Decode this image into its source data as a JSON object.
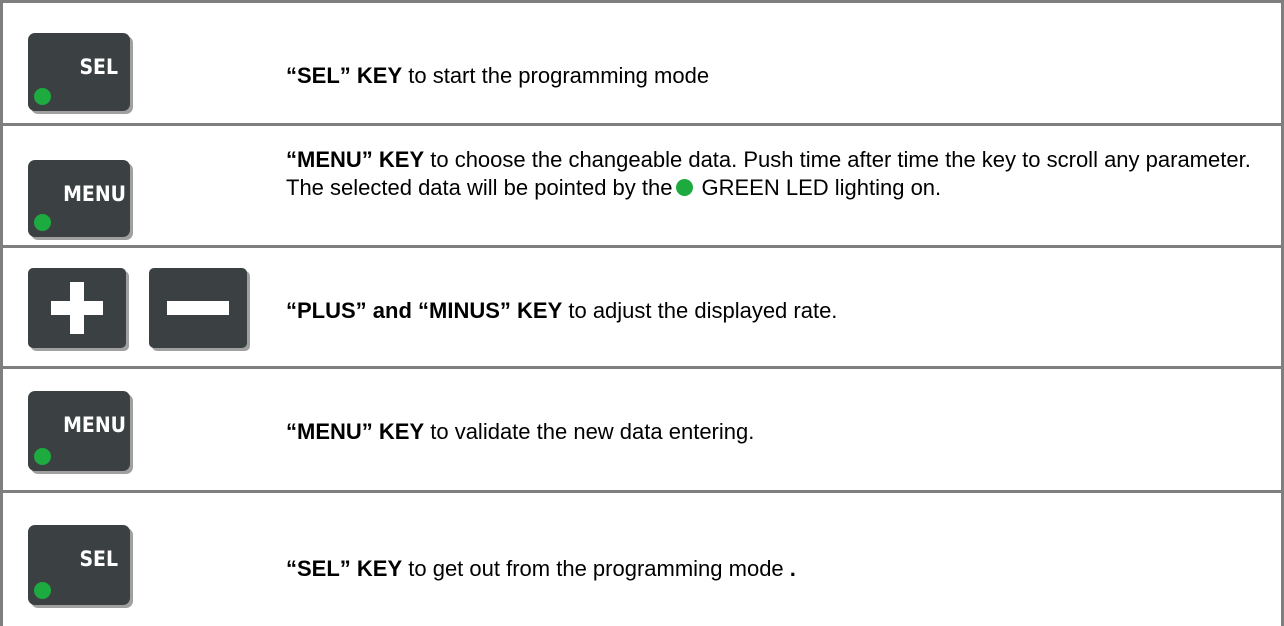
{
  "rows": [
    {
      "key_label": "SEL",
      "bold": "“SEL” KEY",
      "text": " to start the programming mode"
    },
    {
      "key_label": "MENU",
      "bold": "“MENU” KEY",
      "text_before_led": " to choose the changeable data. Push time after time the key to scroll any parameter. The selected data will be pointed by the",
      "text_after_led": "GREEN  LED lighting on."
    },
    {
      "bold": "“PLUS” and “MINUS” KEY",
      "text": " to adjust the displayed rate."
    },
    {
      "key_label": "MENU",
      "bold": "“MENU” KEY",
      "text": " to validate the new data entering."
    },
    {
      "key_label": "SEL",
      "bold": "“SEL” KEY",
      "text": " to get out from the programming mode ",
      "trailing": "."
    }
  ],
  "colors": {
    "key_body": "#3b4143",
    "led_green": "#1dab3f",
    "border": "#7f7f7f"
  },
  "icons": [
    "led-icon",
    "plus-icon",
    "minus-icon"
  ]
}
